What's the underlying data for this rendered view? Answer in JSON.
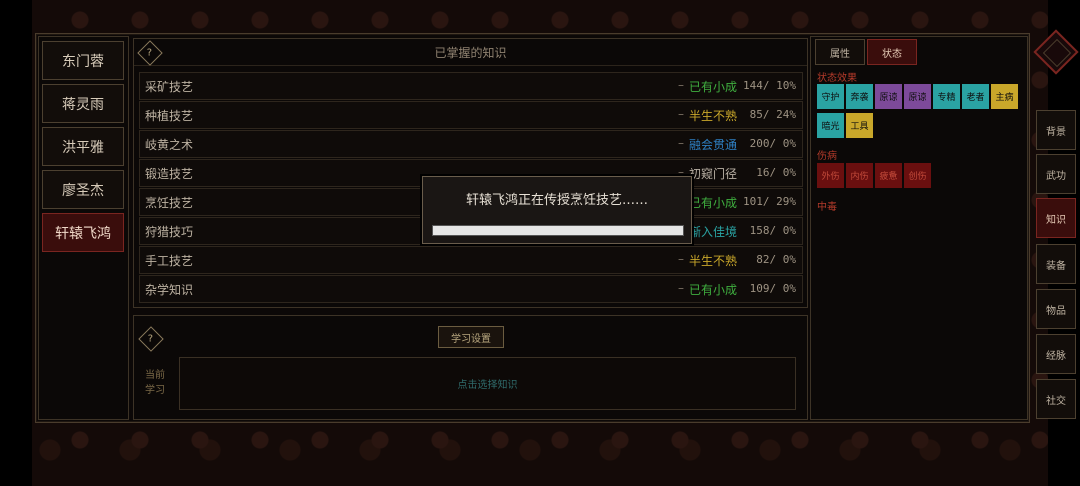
{
  "characters": [
    "东门蓉",
    "蒋灵雨",
    "洪平雅",
    "廖圣杰",
    "轩辕飞鸿"
  ],
  "knowledge": {
    "title": "已掌握的知识",
    "rows": [
      {
        "name": "采矿技艺",
        "level": "已有小成",
        "color": "#3fae3f",
        "progress": "144/",
        "pct": "10%"
      },
      {
        "name": "种植技艺",
        "level": "半生不熟",
        "color": "#c9a72a",
        "progress": "85/",
        "pct": "24%"
      },
      {
        "name": "岐黄之术",
        "level": "融会贯通",
        "color": "#2e7fc2",
        "progress": "200/",
        "pct": "0%"
      },
      {
        "name": "锻造技艺",
        "level": "初窥门径",
        "color": "#b8b0a4",
        "progress": "16/",
        "pct": "0%"
      },
      {
        "name": "烹饪技艺",
        "level": "已有小成",
        "color": "#3fae3f",
        "progress": "101/",
        "pct": "29%"
      },
      {
        "name": "狩猎技巧",
        "level": "渐入佳境",
        "color": "#2aa3a3",
        "progress": "158/",
        "pct": "0%"
      },
      {
        "name": "手工技艺",
        "level": "半生不熟",
        "color": "#c9a72a",
        "progress": "82/",
        "pct": "0%"
      },
      {
        "name": "杂学知识",
        "level": "已有小成",
        "color": "#3fae3f",
        "progress": "109/",
        "pct": "0%"
      }
    ]
  },
  "study": {
    "button": "学习设置",
    "label_line1": "当前",
    "label_line2": "学习",
    "placeholder": "点击选择知识"
  },
  "status_panel": {
    "tabs": [
      "属性",
      "状态"
    ],
    "effects_title": "状态效果",
    "effects": [
      {
        "label": "守护",
        "color": "#2aa3a3"
      },
      {
        "label": "奔袭",
        "color": "#2aa3a3"
      },
      {
        "label": "原谅",
        "color": "#7d4a9a"
      },
      {
        "label": "原谅",
        "color": "#7d4a9a"
      },
      {
        "label": "专精",
        "color": "#2aa3a3"
      },
      {
        "label": "老者",
        "color": "#2aa3a3"
      },
      {
        "label": "主病",
        "color": "#c9a72a"
      },
      {
        "label": "暗光",
        "color": "#2aa3a3"
      },
      {
        "label": "工具",
        "color": "#c9a72a"
      }
    ],
    "injury_title": "伤病",
    "injuries": [
      "外伤",
      "内伤",
      "疲惫",
      "创伤"
    ],
    "poison_title": "中毒"
  },
  "nav": [
    "背景",
    "武功",
    "知识",
    "装备",
    "物品",
    "经脉",
    "社交"
  ],
  "modal": {
    "message": "轩辕飞鸿正在传授烹饪技艺……",
    "progress": 1.0
  }
}
